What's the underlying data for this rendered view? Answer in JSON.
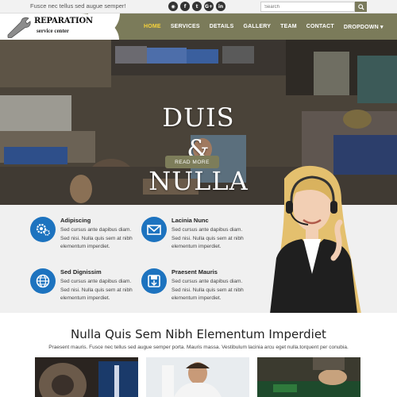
{
  "topbar": {
    "tagline": "Fusce nec tellus sed augue semper!",
    "social": [
      "rss",
      "f",
      "t",
      "G+",
      "in"
    ],
    "search_placeholder": "Search"
  },
  "logo": {
    "title": "REPARATION",
    "subtitle": "service center"
  },
  "nav": {
    "items": [
      "HOME",
      "SERVICES",
      "DETAILS",
      "GALLERY",
      "TEAM",
      "CONTACT",
      "DROPDOWN"
    ],
    "active_color": "#f5d23b"
  },
  "hero": {
    "line1": "DUIS",
    "line2": "&",
    "line3": "NULLA",
    "button": "READ MORE"
  },
  "features": [
    {
      "title": "Adipiscing",
      "desc": "Sed cursus ante dapibus diam. Sed nisi. Nulla quis sem at nibh elementum imperdiet.",
      "icon": "gears-icon"
    },
    {
      "title": "Lacinia Nunc",
      "desc": "Sed cursus ante dapibus diam. Sed nisi. Nulla quis sem at nibh elementum imperdiet.",
      "icon": "envelope-icon"
    },
    {
      "title": "Sed Dignissim",
      "desc": "Sed cursus ante dapibus diam. Sed nisi. Nulla quis sem at nibh elementum imperdiet.",
      "icon": "globe-icon"
    },
    {
      "title": "Praesent Mauris",
      "desc": "Sed cursus ante dapibus diam. Sed nisi. Nulla quis sem at nibh elementum imperdiet.",
      "icon": "save-icon"
    }
  ],
  "section": {
    "title": "Nulla Quis Sem Nibh Elementum Imperdiet",
    "desc": "Praesent mauris. Fusce nec tellus sed augue semper porta. Mauris massa. Vestibulum lacinia arcu eget nulla.torquent per conubia."
  },
  "colors": {
    "header": "#7b7b5a",
    "accent_blue": "#1d73bf",
    "feature_bg": "#f0f0f0"
  }
}
